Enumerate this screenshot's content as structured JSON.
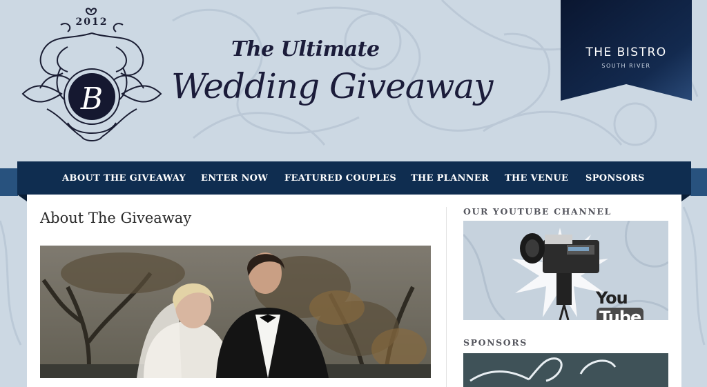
{
  "header": {
    "crest_year": "2012",
    "crest_initial": "B",
    "title_line1": "The Ultimate",
    "title_line2": "Wedding Giveaway"
  },
  "venue_banner": {
    "name": "THE BISTRO",
    "subtitle": "SOUTH RIVER"
  },
  "nav": {
    "items": [
      {
        "label": "ABOUT THE GIVEAWAY"
      },
      {
        "label": "ENTER NOW"
      },
      {
        "label": "FEATURED COUPLES"
      },
      {
        "label": "THE PLANNER"
      },
      {
        "label": "THE VENUE"
      },
      {
        "label": "SPONSORS"
      }
    ]
  },
  "main": {
    "page_title": "About The Giveaway"
  },
  "sidebar": {
    "youtube_heading": "OUR YOUTUBE CHANNEL",
    "youtube_logo_you": "You",
    "youtube_logo_tube": "Tube",
    "sponsors_heading": "SPONSORS"
  },
  "colors": {
    "page_background": "#ccd8e3",
    "nav_background": "#0f2d50",
    "banner_navy": "#0b1a33",
    "title_ink": "#1b1c3a"
  }
}
